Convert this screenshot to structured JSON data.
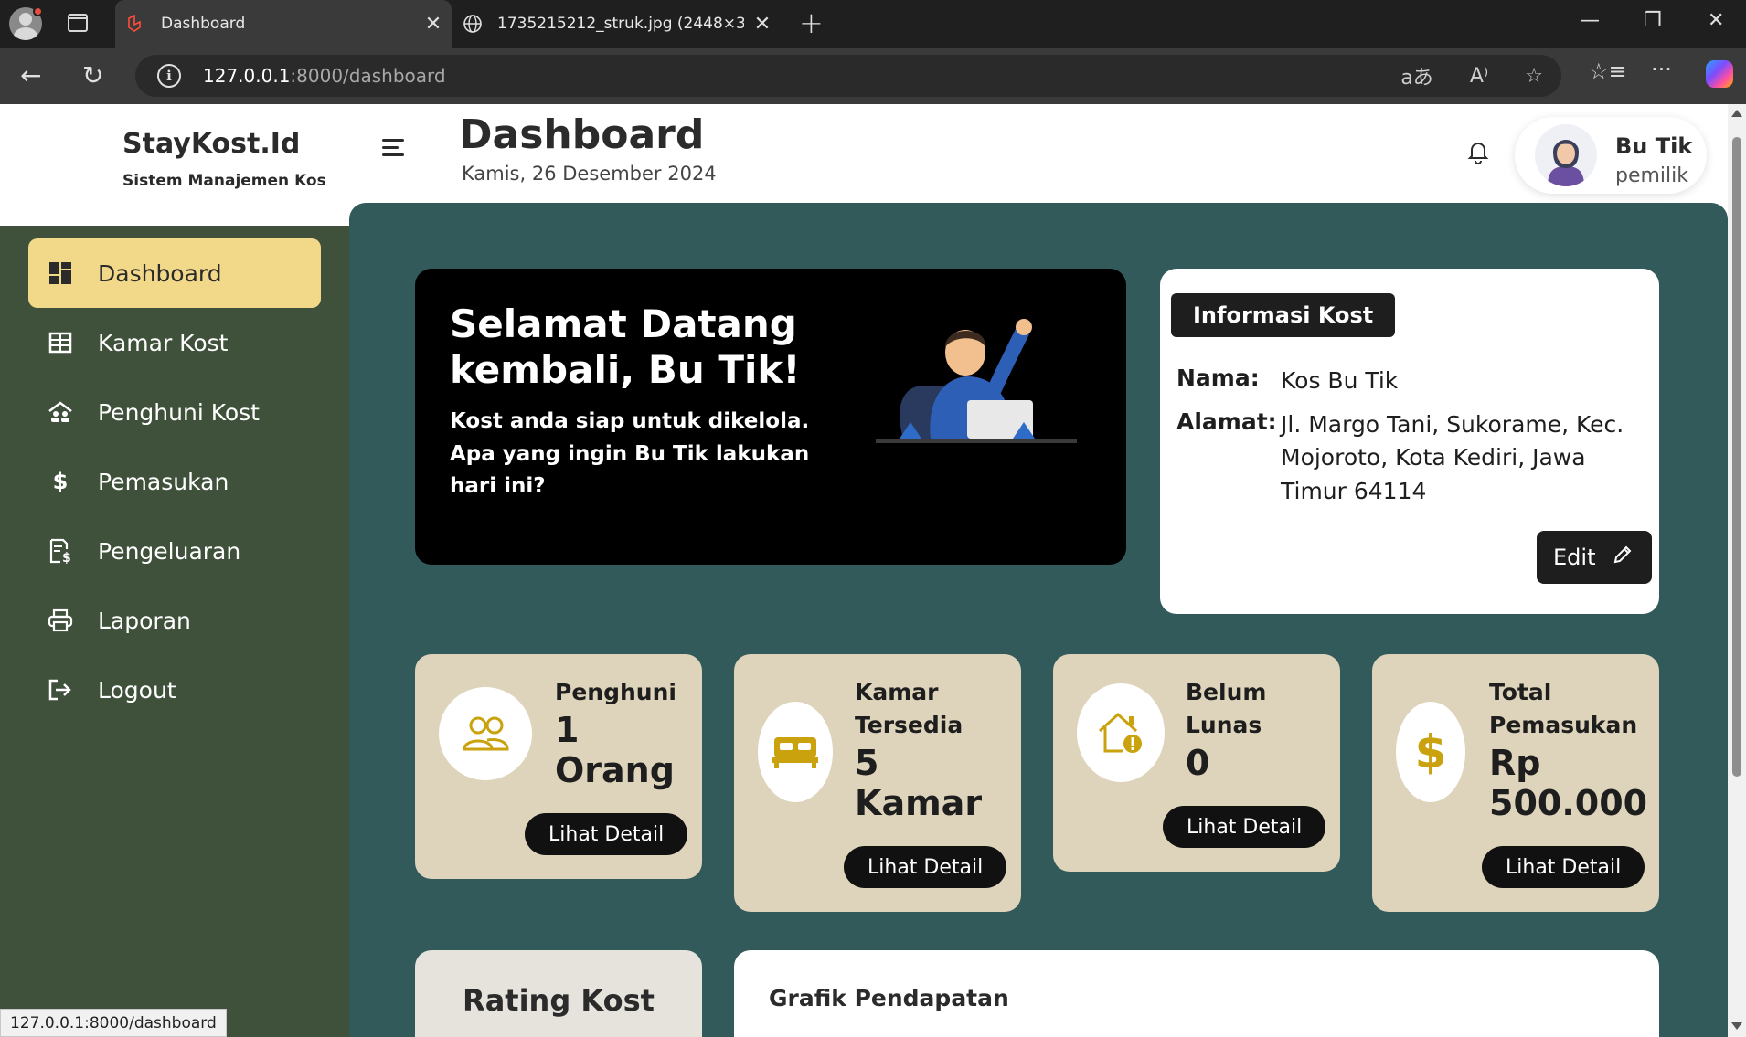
{
  "browser": {
    "tabs": [
      {
        "title": "Dashboard",
        "active": true
      },
      {
        "title": "1735215212_struk.jpg (2448×3264)",
        "active": false
      }
    ],
    "url_host": "127.0.0.1",
    "url_rest": ":8000/dashboard",
    "status_url": "127.0.0.1:8000/dashboard"
  },
  "brand": {
    "name": "StayKost.Id",
    "subtitle": "Sistem Manajemen Kos"
  },
  "sidebar": {
    "items": [
      {
        "label": "Dashboard",
        "icon": "dashboard-icon"
      },
      {
        "label": "Kamar Kost",
        "icon": "room-icon"
      },
      {
        "label": "Penghuni Kost",
        "icon": "residents-icon"
      },
      {
        "label": "Pemasukan",
        "icon": "dollar-icon"
      },
      {
        "label": "Pengeluaran",
        "icon": "expense-icon"
      },
      {
        "label": "Laporan",
        "icon": "printer-icon"
      },
      {
        "label": "Logout",
        "icon": "logout-icon"
      }
    ]
  },
  "header": {
    "title": "Dashboard",
    "date": "Kamis, 26 Desember 2024",
    "user_name": "Bu Tik",
    "user_role": "pemilik"
  },
  "welcome": {
    "title": "Selamat Datang kembali, Bu Tik!",
    "subtitle": "Kost anda siap untuk dikelola. Apa yang ingin Bu Tik lakukan hari ini?"
  },
  "info": {
    "heading": "Informasi Kost",
    "name_label": "Nama:",
    "name_value": "Kos Bu Tik",
    "address_label": "Alamat:",
    "address_value": "Jl. Margo Tani, Sukorame, Kec. Mojoroto, Kota Kediri, Jawa Timur 64114",
    "edit_label": "Edit"
  },
  "stats": [
    {
      "label": "Penghuni",
      "value": "1 Orang",
      "button": "Lihat Detail",
      "icon": "users-icon"
    },
    {
      "label": "Kamar Tersedia",
      "value": "5 Kamar",
      "button": "Lihat Detail",
      "icon": "bed-icon"
    },
    {
      "label": "Belum Lunas",
      "value": "0",
      "button": "Lihat Detail",
      "icon": "house-alert-icon"
    },
    {
      "label": "Total Pemasukan",
      "value": "Rp 500.000",
      "button": "Lihat Detail",
      "icon": "dollar-icon"
    }
  ],
  "rating": {
    "title": "Rating Kost",
    "stars": "★★★★★"
  },
  "graph": {
    "title": "Grafik Pendapatan"
  },
  "colors": {
    "sidebar": "#3f513b",
    "active_nav": "#f2d98a",
    "main_bg": "#325a5b",
    "stat_card": "#ded4bb",
    "accent_icon": "#c9a20e"
  }
}
